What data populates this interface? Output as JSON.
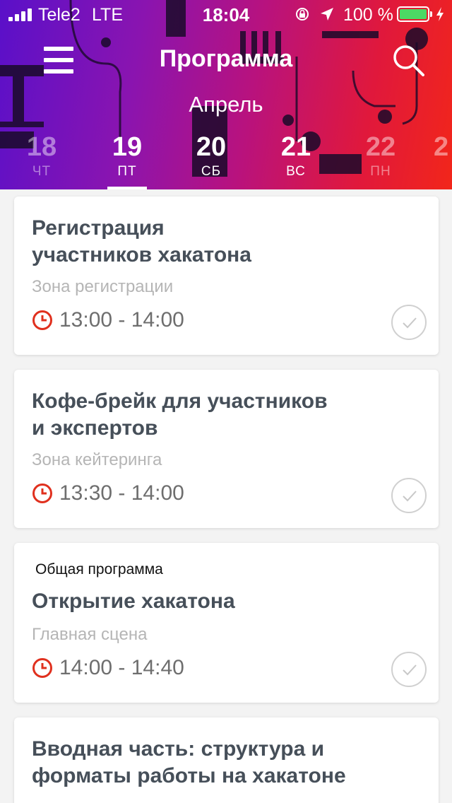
{
  "status_bar": {
    "carrier": "Tele2",
    "network": "LTE",
    "time": "18:04",
    "battery_percent": "100 %",
    "battery_color": "#4cd964"
  },
  "header": {
    "title": "Программа",
    "month": "Апрель",
    "menu_icon": "hamburger-menu-icon",
    "search_icon": "search-icon",
    "gradient": [
      "#5a10c9",
      "#b8127e",
      "#f2261a"
    ]
  },
  "days": [
    {
      "num": "18",
      "dow": "ЧТ"
    },
    {
      "num": "19",
      "dow": "ПТ"
    },
    {
      "num": "20",
      "dow": "СБ"
    },
    {
      "num": "21",
      "dow": "ВС"
    },
    {
      "num": "22",
      "dow": "ПН"
    },
    {
      "num": "2",
      "dow": ""
    }
  ],
  "selected_day": "19",
  "events": [
    {
      "tag": "",
      "title_line1": "Регистрация",
      "title_line2": "участников хакатона",
      "place": "Зона регистрации",
      "time": "13:00 - 14:00"
    },
    {
      "tag": "",
      "title_line1": "Кофе-брейк для участников",
      "title_line2": "и экспертов",
      "place": "Зона кейтеринга",
      "time": "13:30 - 14:00"
    },
    {
      "tag": "Общая программа",
      "title_line1": "Открытие хакатона",
      "title_line2": "",
      "place": "Главная сцена",
      "time": "14:00 - 14:40"
    },
    {
      "tag": "",
      "title_line1": "Вводная часть: структура и",
      "title_line2": "форматы работы на хакатоне",
      "place": "",
      "time": ""
    }
  ],
  "colors": {
    "clock_icon": "#e0301e",
    "title_text": "#464f59",
    "place_text": "#b5b5b5",
    "check_border": "#d0d0d0"
  }
}
